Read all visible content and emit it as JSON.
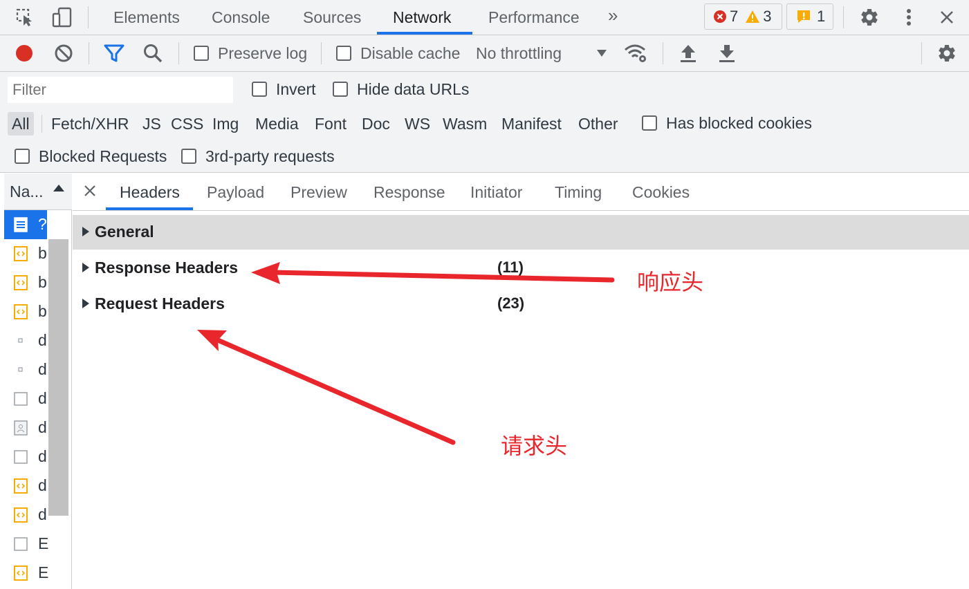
{
  "top_tabs": [
    "Elements",
    "Console",
    "Sources",
    "Network",
    "Performance"
  ],
  "active_tab": "Network",
  "more_tabs_glyph": "»",
  "counters": {
    "errors": "7",
    "warnings": "3",
    "issues": "1"
  },
  "toolbar": {
    "preserve_log": "Preserve log",
    "disable_cache": "Disable cache",
    "throttling": "No throttling"
  },
  "filter": {
    "placeholder": "Filter",
    "invert": "Invert",
    "hide_data_urls": "Hide data URLs",
    "types": [
      "All",
      "Fetch/XHR",
      "JS",
      "CSS",
      "Img",
      "Media",
      "Font",
      "Doc",
      "WS",
      "Wasm",
      "Manifest",
      "Other"
    ],
    "active_type": "All",
    "has_blocked_cookies": "Has blocked cookies",
    "blocked_requests": "Blocked Requests",
    "third_party": "3rd-party requests"
  },
  "request_list": {
    "header": "Na...",
    "rows": [
      {
        "name": "?",
        "icon": "document-icon",
        "selected": true
      },
      {
        "name": "b",
        "icon": "script-icon"
      },
      {
        "name": "b",
        "icon": "script-icon"
      },
      {
        "name": "b",
        "icon": "script-icon"
      },
      {
        "name": "d",
        "icon": "dot-icon"
      },
      {
        "name": "d",
        "icon": "dot-icon"
      },
      {
        "name": "d",
        "icon": "blank-file-icon"
      },
      {
        "name": "d",
        "icon": "image-icon"
      },
      {
        "name": "d",
        "icon": "blank-file-icon"
      },
      {
        "name": "d",
        "icon": "script-icon"
      },
      {
        "name": "d",
        "icon": "script-icon"
      },
      {
        "name": "E",
        "icon": "blank-file-icon"
      },
      {
        "name": "E",
        "icon": "script-icon"
      }
    ]
  },
  "detail_tabs": [
    "Headers",
    "Payload",
    "Preview",
    "Response",
    "Initiator",
    "Timing",
    "Cookies"
  ],
  "active_detail_tab": "Headers",
  "sections": [
    {
      "title": "General",
      "count": ""
    },
    {
      "title": "Response Headers",
      "count": "(11)"
    },
    {
      "title": "Request Headers",
      "count": "(23)"
    }
  ],
  "annotations": {
    "response": "响应头",
    "request": "请求头"
  },
  "colors": {
    "accent": "#1a73e8",
    "annotation": "#e8262b",
    "record": "#d93025"
  }
}
